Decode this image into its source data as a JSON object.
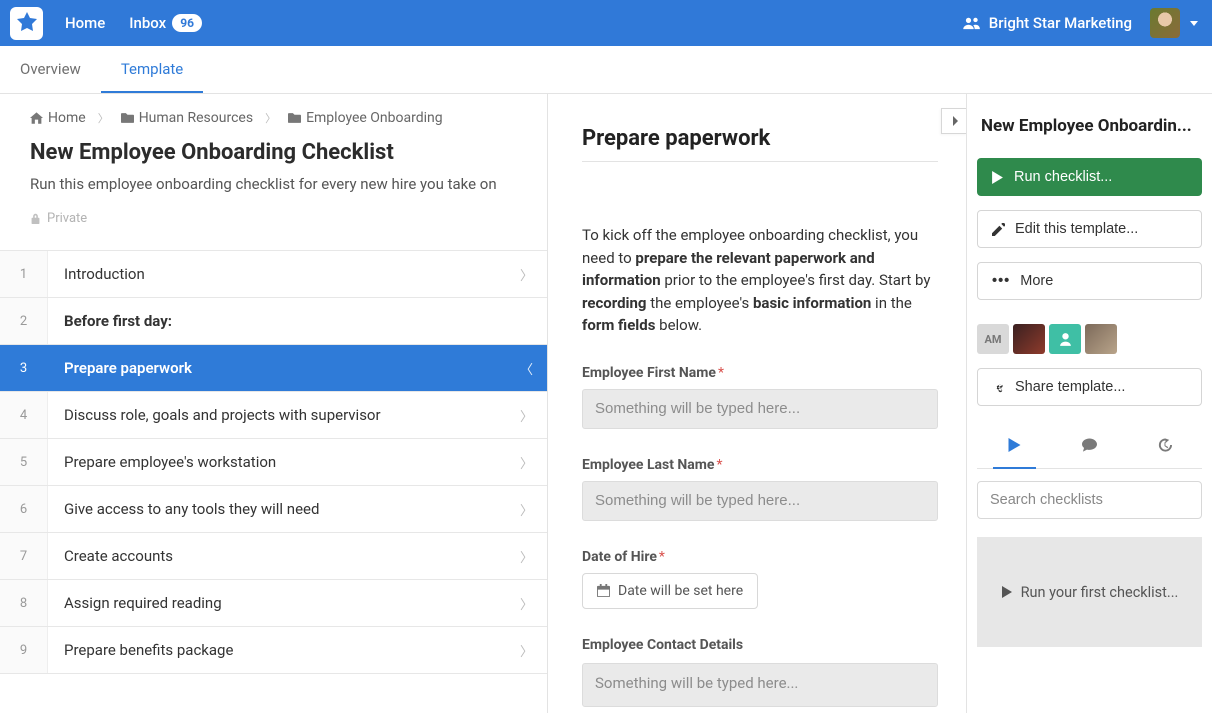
{
  "nav": {
    "home": "Home",
    "inbox": "Inbox",
    "inbox_count": "96",
    "org_name": "Bright Star Marketing"
  },
  "subnav": {
    "overview": "Overview",
    "template": "Template"
  },
  "breadcrumbs": {
    "home": "Home",
    "hr": "Human Resources",
    "folder": "Employee Onboarding"
  },
  "page": {
    "title": "New Employee Onboarding Checklist",
    "description": "Run this employee onboarding checklist for every new hire you take on",
    "privacy": "Private"
  },
  "steps": [
    {
      "num": "1",
      "label": "Introduction"
    },
    {
      "num": "2",
      "label": "Before first day:"
    },
    {
      "num": "3",
      "label": "Prepare paperwork"
    },
    {
      "num": "4",
      "label": "Discuss role, goals and projects with supervisor"
    },
    {
      "num": "5",
      "label": "Prepare employee's workstation"
    },
    {
      "num": "6",
      "label": "Give access to any tools they will need"
    },
    {
      "num": "7",
      "label": "Create accounts"
    },
    {
      "num": "8",
      "label": "Assign required reading"
    },
    {
      "num": "9",
      "label": "Prepare benefits package"
    }
  ],
  "content": {
    "title": "Prepare paperwork",
    "intro1": "To kick off the employee onboarding checklist, you need to ",
    "bold1": "prepare the relevant paperwork and information",
    "intro2": " prior to the employee's first day. Start by ",
    "bold2": "recording",
    "intro3": " the employee's ",
    "bold3": "basic information",
    "intro4": " in the ",
    "bold4": "form fields",
    "intro5": " below."
  },
  "form": {
    "first_name_label": "Employee First Name",
    "last_name_label": "Employee Last Name",
    "date_label": "Date of Hire",
    "date_placeholder": "Date will be set here",
    "contact_label": "Employee Contact Details",
    "placeholder": "Something will be typed here..."
  },
  "sidebar": {
    "title": "New Employee Onboardin...",
    "run_checklist": "Run checklist...",
    "edit_template": "Edit this template...",
    "more": "More",
    "chip_text": "AM",
    "share": "Share template...",
    "search_placeholder": "Search checklists",
    "run_first": "Run your first checklist..."
  }
}
